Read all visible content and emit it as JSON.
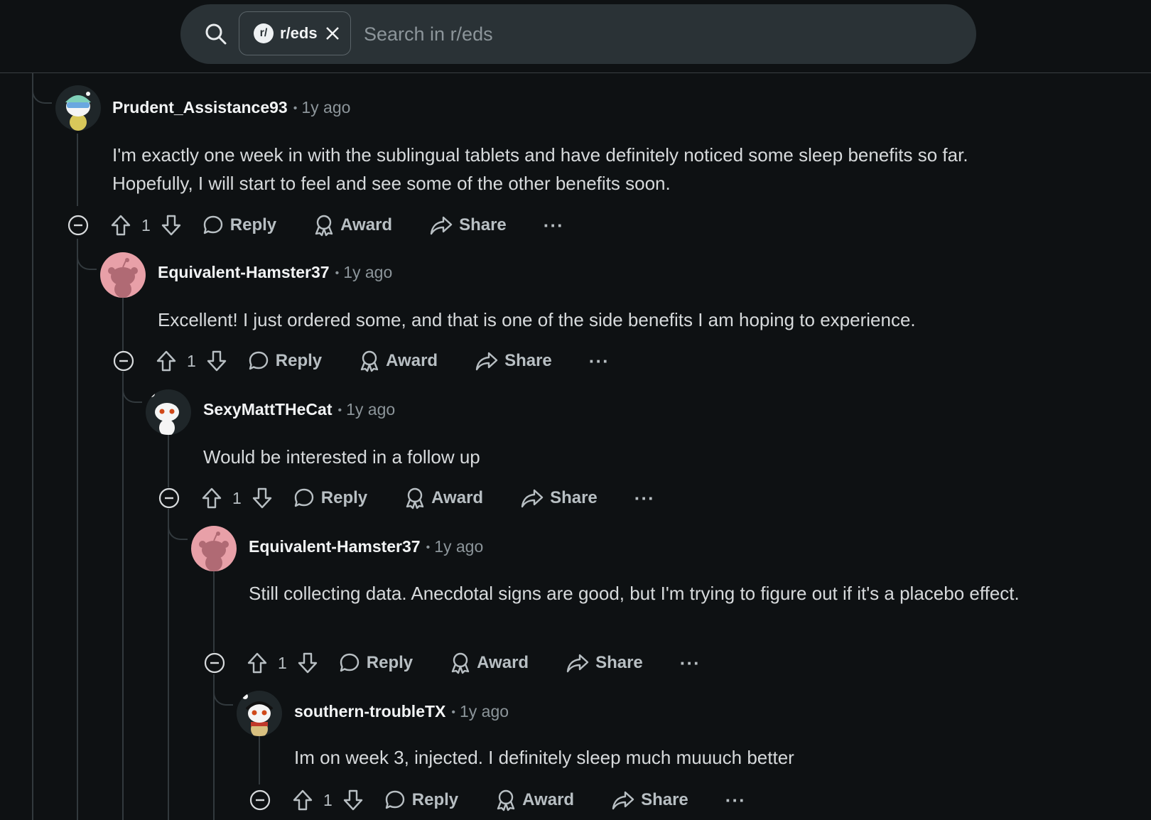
{
  "search": {
    "community_chip": "r/eds",
    "chip_icon_text": "r/",
    "placeholder": "Search in r/eds"
  },
  "comments": [
    {
      "author": "Prudent_Assistance93",
      "time": "1y ago",
      "avatar": "snoo-avatar-goggles",
      "body": "I'm exactly one week in with the sublingual tablets and have definitely noticed some sleep benefits so far. Hopefully, I will start to feel and see some of the other benefits soon.",
      "score": "1"
    },
    {
      "author": "Equivalent-Hamster37",
      "time": "1y ago",
      "avatar": "snoo-avatar-default-pink",
      "body": "Excellent! I just ordered some, and that is one of the side benefits I am hoping to experience.",
      "score": "1"
    },
    {
      "author": "SexyMattTHeCat",
      "time": "1y ago",
      "avatar": "snoo-avatar-white",
      "body": "Would be interested in a follow up",
      "score": "1"
    },
    {
      "author": "Equivalent-Hamster37",
      "time": "1y ago",
      "avatar": "snoo-avatar-default-pink",
      "body": "Still collecting data. Anecdotal signs are good, but I'm trying to figure out if it's a placebo effect.",
      "score": "1"
    },
    {
      "author": "southern-troubleTX",
      "time": "1y ago",
      "avatar": "snoo-avatar-scarf",
      "body": "Im on week 3, injected. I definitely sleep much muuuch better",
      "score": "1"
    }
  ],
  "actions": {
    "reply": "Reply",
    "award": "Award",
    "share": "Share",
    "more": "···"
  },
  "colors": {
    "background": "#0e1113",
    "search_bg": "#2a3236",
    "text": "#d7dadc",
    "muted": "#8c959a",
    "thread_line": "#32393d",
    "pink_avatar": "#e8a0a8"
  }
}
